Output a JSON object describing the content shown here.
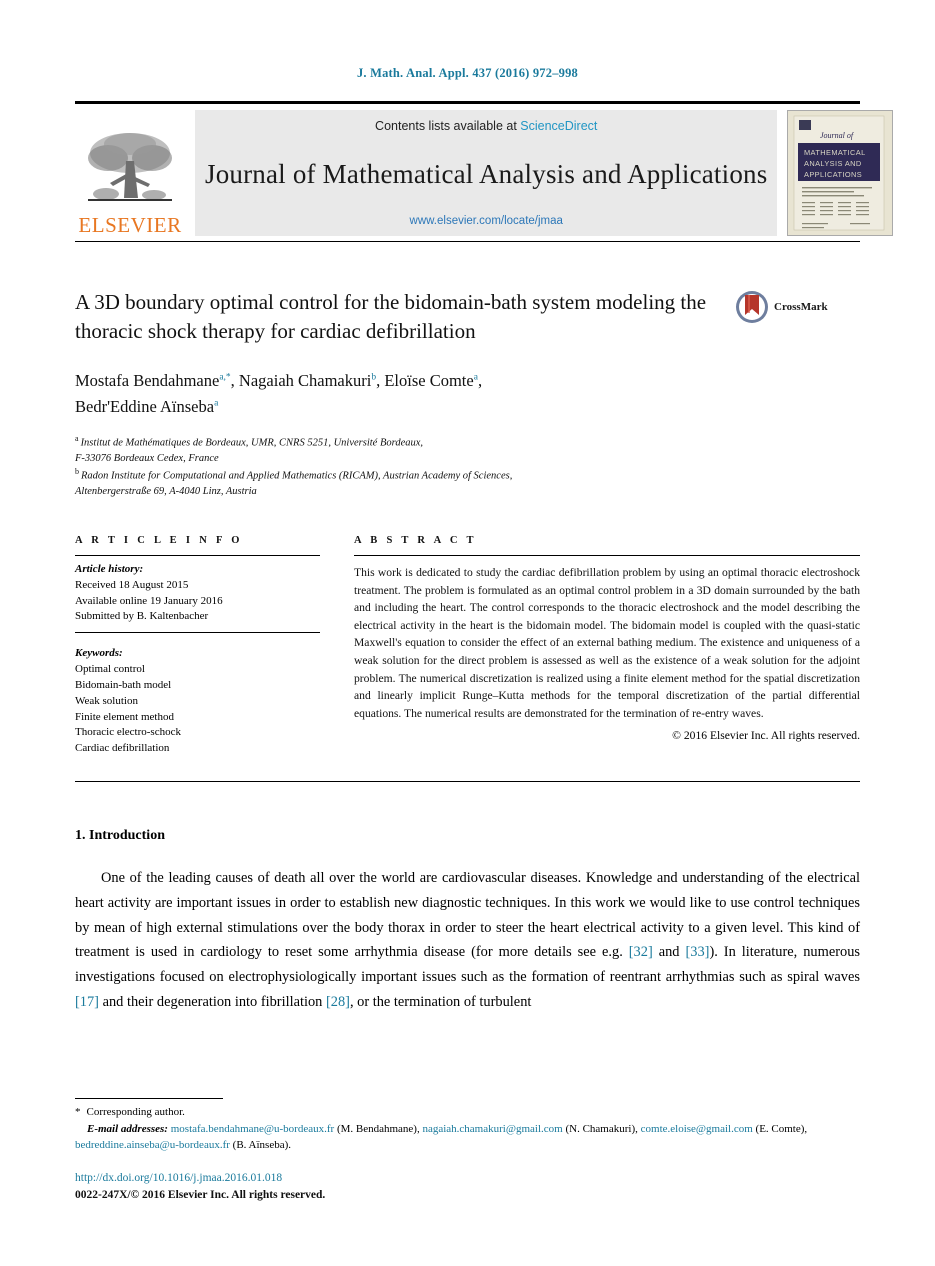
{
  "running_head": "J. Math. Anal. Appl. 437 (2016) 972–998",
  "masthead": {
    "publisher_name": "ELSEVIER",
    "contents_prefix": "Contents lists available at ",
    "contents_link": "ScienceDirect",
    "journal_title": "Journal of Mathematical Analysis and Applications",
    "journal_url": "www.elsevier.com/locate/jmaa",
    "cover_journal_of": "Journal of",
    "cover_title_line1": "MATHEMATICAL",
    "cover_title_line2": "ANALYSIS AND",
    "cover_title_line3": "APPLICATIONS"
  },
  "article": {
    "title": "A 3D boundary optimal control for the bidomain-bath system modeling the thoracic shock therapy for cardiac defibrillation",
    "crossmark_label": "CrossMark",
    "authors_line1_parts": [
      {
        "name": "Mostafa Bendahmane",
        "marks": "a,*"
      },
      {
        "name": "Nagaiah Chamakuri",
        "marks": "b"
      },
      {
        "name": "Eloïse Comte",
        "marks": "a"
      }
    ],
    "authors_line2_parts": [
      {
        "name": "Bedr'Eddine Aïnseba",
        "marks": "a"
      }
    ],
    "affiliations": [
      {
        "mark": "a",
        "lines": [
          "Institut de Mathématiques de Bordeaux, UMR, CNRS 5251, Université Bordeaux,",
          "F-33076 Bordeaux Cedex, France"
        ]
      },
      {
        "mark": "b",
        "lines": [
          "Radon Institute for Computational and Applied Mathematics (RICAM), Austrian Academy of Sciences,",
          "Altenbergerstraße 69, A-4040 Linz, Austria"
        ]
      }
    ]
  },
  "article_info": {
    "heading": "A R T I C L E   I N F O",
    "history_label": "Article history:",
    "history": [
      "Received 18 August 2015",
      "Available online 19 January 2016",
      "Submitted by B. Kaltenbacher"
    ],
    "keywords_label": "Keywords:",
    "keywords": [
      "Optimal control",
      "Bidomain-bath model",
      "Weak solution",
      "Finite element method",
      "Thoracic electro-schock",
      "Cardiac defibrillation"
    ]
  },
  "abstract": {
    "heading": "A B S T R A C T",
    "text": "This work is dedicated to study the cardiac defibrillation problem by using an optimal thoracic electroshock treatment. The problem is formulated as an optimal control problem in a 3D domain surrounded by the bath and including the heart. The control corresponds to the thoracic electroshock and the model describing the electrical activity in the heart is the bidomain model. The bidomain model is coupled with the quasi-static Maxwell's equation to consider the effect of an external bathing medium. The existence and uniqueness of a weak solution for the direct problem is assessed as well as the existence of a weak solution for the adjoint problem. The numerical discretization is realized using a finite element method for the spatial discretization and linearly implicit Runge–Kutta methods for the temporal discretization of the partial differential equations. The numerical results are demonstrated for the termination of re-entry waves.",
    "copyright": "© 2016 Elsevier Inc. All rights reserved."
  },
  "introduction": {
    "heading": "1. Introduction",
    "paragraph_pre": "One of the leading causes of death all over the world are cardiovascular diseases. Knowledge and understanding of the electrical heart activity are important issues in order to establish new diagnostic techniques. In this work we would like to use control techniques by mean of high external stimulations over the body thorax in order to steer the heart electrical activity to a given level. This kind of treatment is used in cardiology to reset some arrhythmia disease (for more details see e.g. ",
    "ref_1": "[32]",
    "mid_1": " and ",
    "ref_2": "[33]",
    "mid_2": "). In literature, numerous investigations focused on electrophysiologically important issues such as the formation of reentrant arrhythmias such as spiral waves ",
    "ref_3": "[17]",
    "mid_3": " and their degeneration into fibrillation ",
    "ref_4": "[28]",
    "paragraph_post": ", or the termination of turbulent"
  },
  "footer": {
    "corresponding_mark": "*",
    "corresponding_text": "Corresponding author.",
    "email_label": "E-mail addresses:",
    "emails": [
      {
        "address": "mostafa.bendahmane@u-bordeaux.fr",
        "person": " (M. Bendahmane), "
      },
      {
        "address": "nagaiah.chamakuri@gmail.com",
        "person": " (N. Chamakuri), "
      },
      {
        "address": "comte.eloise@gmail.com",
        "person": " (E. Comte), "
      },
      {
        "address": "bedreddine.ainseba@u-bordeaux.fr",
        "person": " (B. Aïnseba)."
      }
    ],
    "doi": "http://dx.doi.org/10.1016/j.jmaa.2016.01.018",
    "issn_line": "0022-247X/© 2016 Elsevier Inc. All rights reserved."
  },
  "colors": {
    "link": "#1a7a9c",
    "sciencedirect": "#2196c4",
    "elsevier_orange": "#E87722",
    "masthead_bg": "#e9e9e9",
    "cover_bg": "#e8e4d2",
    "cover_band": "#2f2a55"
  }
}
